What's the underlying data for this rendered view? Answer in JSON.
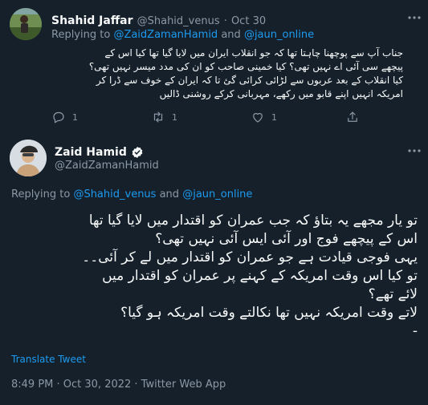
{
  "reply_tweet": {
    "author_name": "Shahid Jaffar",
    "handle": "@Shahid_venus",
    "separator": "·",
    "date": "Oct 30",
    "replying_prefix": "Replying to",
    "mention_1": "@ZaidZamanHamid",
    "and_word": "and",
    "mention_2": "@jaun_online",
    "body_lines": [
      "جناب آپ سے پوچھنا چاہتا تھا کہ جو انقلاب ایران میں لایا گیا تھا کیا اس کے",
      "پیچھے سی آئی اے نہیں تھی؟ کیا خمینی صاحب کو ان کی مدد میسر نہیں تھی؟",
      "کیا انقلاب کے بعد عربوں سے لڑائی کرائی گئ تا کہ ایران کے خوف سے ڈرا کر",
      "امریکہ انہیں اپنے قابو میں رکھے، مہربانی کرکے روشنی ڈالیں"
    ],
    "reply_count": "1",
    "retweet_count": "1",
    "like_count": "1"
  },
  "main_tweet": {
    "author_name": "Zaid Hamid",
    "handle": "@ZaidZamanHamid",
    "replying_prefix": "Replying to",
    "mention_1": "@Shahid_venus",
    "and_word": "and",
    "mention_2": "@jaun_online",
    "body_lines": [
      "تو یار مجھے یہ بتاؤ کہ جب عمران کو اقتدار میں لایا گیا تھا",
      "اس کے  پیچھے فوج اور آئی ایس آئی نہیں تھی؟",
      "یہی فوجی قیادت ہے جو عمران کو اقتدار میں لے کر آئی۔۔",
      "تو کیا اس وقت امریکہ کے کہنے پر عمران کو اقتدار میں",
      "لائے تھے؟",
      "لاتے وقت امریکہ نہیں تھا نکالتے وقت امریکہ ہو گیا؟",
      "-"
    ],
    "translate_label": "Translate Tweet",
    "timestamp": "8:49 PM · Oct 30, 2022 · Twitter Web App"
  },
  "icons": {
    "more": "more-dots-icon",
    "reply": "reply-icon",
    "retweet": "retweet-icon",
    "like": "like-icon",
    "share": "share-icon",
    "verified": "verified-badge-icon"
  },
  "colors": {
    "background": "#15202b",
    "text": "#f7f9f9",
    "muted": "#8b98a5",
    "link": "#1d9bf0",
    "divider": "#38444d"
  }
}
